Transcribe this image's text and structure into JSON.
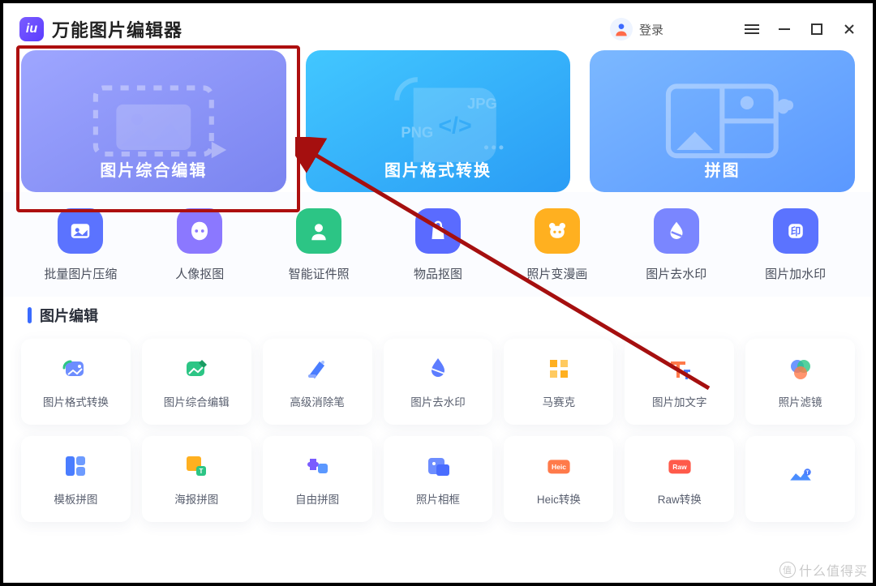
{
  "app": {
    "title": "万能图片编辑器",
    "login": "登录",
    "logo_text": "iu"
  },
  "hero": [
    {
      "label": "图片综合编辑",
      "name": "hero-image-edit"
    },
    {
      "label": "图片格式转换",
      "name": "hero-format-convert",
      "badge_png": "PNG",
      "badge_jpg": "JPG"
    },
    {
      "label": "拼图",
      "name": "hero-collage"
    }
  ],
  "tools": [
    {
      "label": "批量图片压缩",
      "name": "tool-batch-compress",
      "color": "#5b73ff"
    },
    {
      "label": "人像抠图",
      "name": "tool-portrait-cutout",
      "color": "#8b78ff"
    },
    {
      "label": "智能证件照",
      "name": "tool-id-photo",
      "color": "#2cc585"
    },
    {
      "label": "物品抠图",
      "name": "tool-object-cutout",
      "color": "#5a6bff"
    },
    {
      "label": "照片变漫画",
      "name": "tool-photo-comic",
      "color": "#ffb020",
      "bg": "#fff1d4"
    },
    {
      "label": "图片去水印",
      "name": "tool-remove-watermark",
      "color": "#7a86ff"
    },
    {
      "label": "图片加水印",
      "name": "tool-add-watermark",
      "color": "#5b73ff"
    }
  ],
  "section": {
    "title": "图片编辑"
  },
  "cards_row1": [
    {
      "label": "图片格式转换",
      "name": "card-format-convert"
    },
    {
      "label": "图片综合编辑",
      "name": "card-image-edit"
    },
    {
      "label": "高级消除笔",
      "name": "card-eraser"
    },
    {
      "label": "图片去水印",
      "name": "card-remove-watermark"
    },
    {
      "label": "马赛克",
      "name": "card-mosaic"
    },
    {
      "label": "图片加文字",
      "name": "card-add-text"
    },
    {
      "label": "照片滤镜",
      "name": "card-photo-filter"
    }
  ],
  "cards_row2": [
    {
      "label": "模板拼图",
      "name": "card-template-collage"
    },
    {
      "label": "海报拼图",
      "name": "card-poster-collage"
    },
    {
      "label": "自由拼图",
      "name": "card-free-collage"
    },
    {
      "label": "照片相框",
      "name": "card-photo-frame"
    },
    {
      "label": "Heic转换",
      "name": "card-heic-convert",
      "tag": "Heic"
    },
    {
      "label": "Raw转换",
      "name": "card-raw-convert",
      "tag": "Raw"
    },
    {
      "label": "",
      "name": "card-more"
    }
  ],
  "watermark": {
    "text": "什么值得买",
    "logo_text": "值"
  },
  "colors": {
    "accent": "#3a6bff",
    "highlight": "#ad0f0f"
  }
}
